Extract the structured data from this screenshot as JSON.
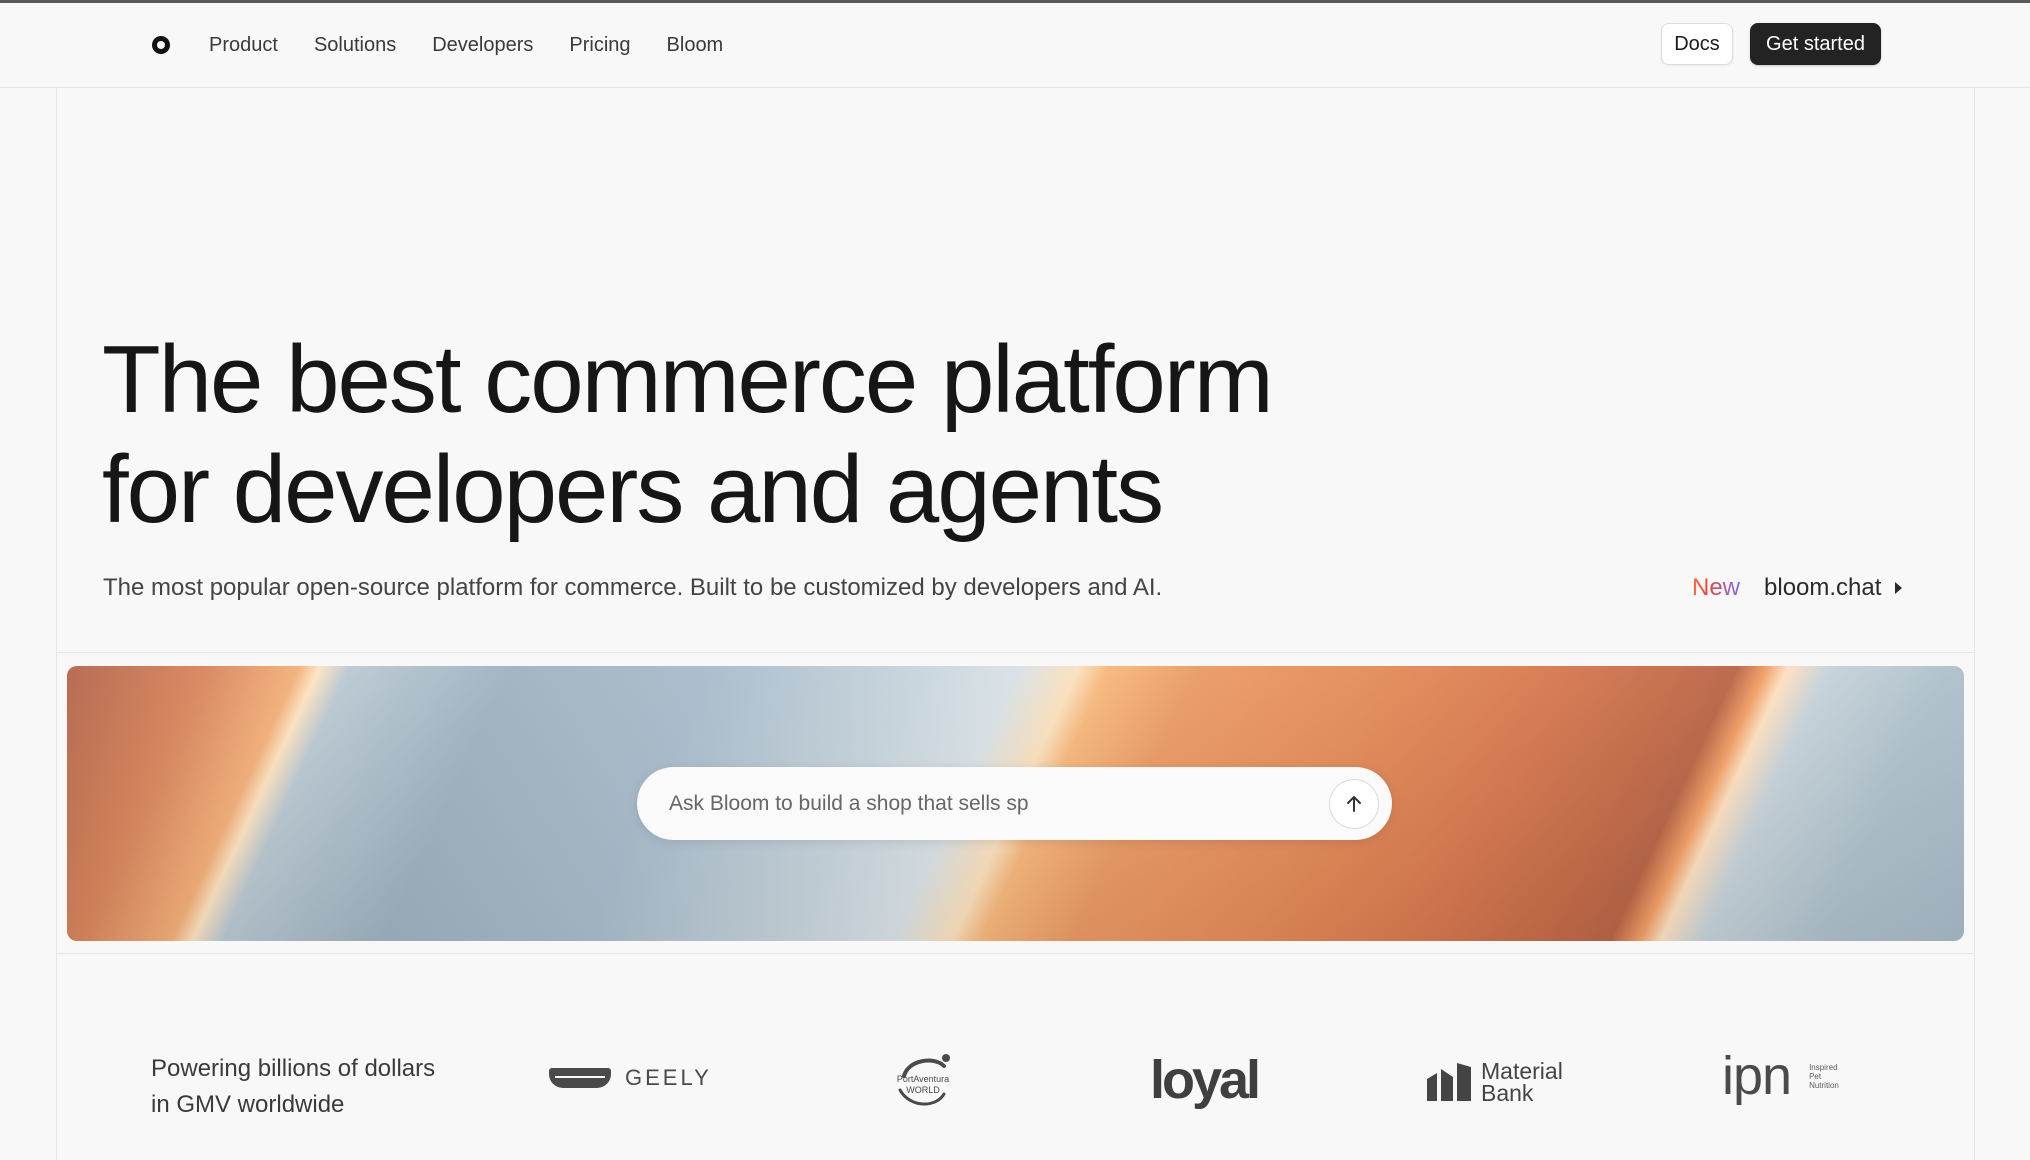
{
  "nav": {
    "logo_icon": "circle-logo-icon",
    "items": [
      "Product",
      "Solutions",
      "Developers",
      "Pricing",
      "Bloom"
    ],
    "docs_label": "Docs",
    "cta_label": "Get started"
  },
  "hero": {
    "title_line1": "The best commerce platform",
    "title_line2": "for developers and agents",
    "subtitle": "The most popular open-source platform for commerce. Built to be customized by developers and AI.",
    "announcement": {
      "badge": "New",
      "link": "bloom.chat"
    }
  },
  "prompt": {
    "placeholder": "Ask Bloom to build a shop that sells sp",
    "send_icon": "arrow-up-icon"
  },
  "logos": {
    "tagline": "Powering billions of dollars in GMV worldwide",
    "brands": [
      {
        "name": "GEELY"
      },
      {
        "name": "PortAventura WORLD"
      },
      {
        "name": "loyal"
      },
      {
        "name": "Material Bank"
      },
      {
        "name": "ipn",
        "tagline": "Inspired Pet Nutrition"
      }
    ]
  },
  "colors": {
    "cta_background": "#232323",
    "new_badge_gradient": [
      "#ff6a3d",
      "#e8433a",
      "#7b6cf6"
    ],
    "banner_orange": "#e48a58",
    "banner_blue": "#a9bccb"
  }
}
